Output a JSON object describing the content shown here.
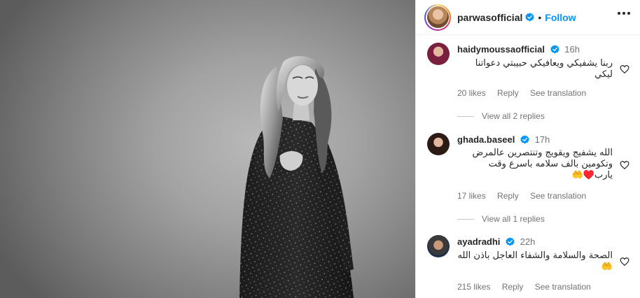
{
  "post_header": {
    "username": "parwasofficial",
    "separator": "•",
    "follow_label": "Follow"
  },
  "comments": [
    {
      "username": "haidymoussaofficial",
      "time": "16h",
      "text": "ربنا يشفيكي ويعافيكي حبيبتي دعواتنا ليكي",
      "likes": "20 likes",
      "reply_label": "Reply",
      "translation_label": "See translation",
      "replies_label": "View all 2 replies"
    },
    {
      "username": "ghada.baseel",
      "time": "17h",
      "text": "الله يشفيج ويقويج وتنتصرين عالمرض وتكومين بالف سلامه باسرع وقت يارب♥️🤲",
      "likes": "17 likes",
      "reply_label": "Reply",
      "translation_label": "See translation",
      "replies_label": "View all 1 replies"
    },
    {
      "username": "ayadradhi",
      "time": "22h",
      "text": "الصحة والسلامة والشفاء العاجل باذن الله 🤲",
      "likes": "215 likes",
      "reply_label": "Reply",
      "translation_label": "See translation"
    }
  ],
  "colors": {
    "accent": "#0095f6",
    "verified": "#0095f6",
    "muted": "#737373"
  },
  "icons": [
    "verified-badge-icon",
    "more-options-icon",
    "heart-icon"
  ]
}
